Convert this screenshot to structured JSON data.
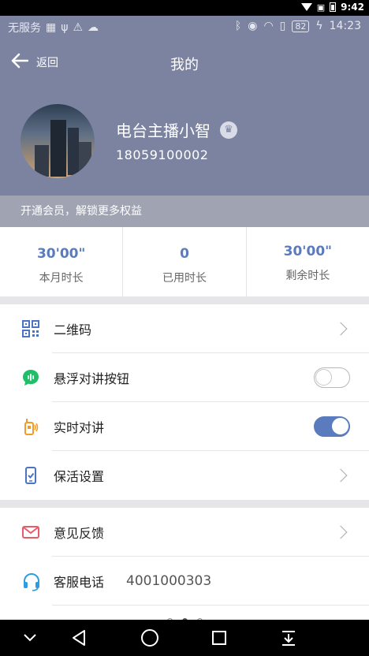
{
  "system_status": {
    "time": "9:42"
  },
  "statusbar": {
    "left_text": "无服务",
    "battery": "82",
    "time": "14:23"
  },
  "nav": {
    "back_label": "返回",
    "title": "我的"
  },
  "profile": {
    "name": "电台主播小智",
    "phone": "18059100002",
    "badge_icon": "crown-icon"
  },
  "vip_banner": "开通会员，解锁更多权益",
  "stats": [
    {
      "value": "30'00\"",
      "label": "本月时长"
    },
    {
      "value": "0",
      "label": "已用时长"
    },
    {
      "value": "30'00\"",
      "label": "剩余时长"
    }
  ],
  "menu": {
    "qrcode": "二维码",
    "float_talk_button": "悬浮对讲按钮",
    "float_talk_on": false,
    "realtime_talk": "实时对讲",
    "realtime_talk_on": true,
    "keepalive": "保活设置",
    "feedback": "意见反馈",
    "customer_service": "客服电话",
    "customer_service_number": "4001000303"
  },
  "colors": {
    "header_bg": "#7b83a0",
    "accent": "#5a7bbd",
    "vip_bar": "#a0a4b2"
  }
}
